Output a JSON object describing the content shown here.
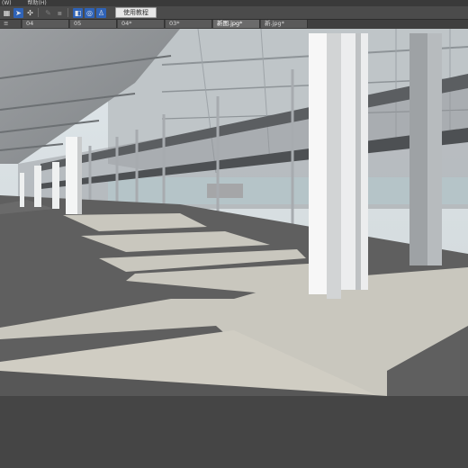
{
  "menubar": {
    "items": [
      "(W)",
      "帮助(H)"
    ]
  },
  "toolbar": {
    "icons": [
      "grid-icon",
      "select-arrow-icon",
      "move-icon",
      "pencil-icon",
      "paint-icon",
      "camera-icon",
      "orbit-icon",
      "walk-icon"
    ],
    "help_label": "使用教程"
  },
  "tabs": [
    {
      "label": "04"
    },
    {
      "label": "05"
    },
    {
      "label": "04*"
    },
    {
      "label": "03*"
    },
    {
      "label": "新图.jpg*"
    },
    {
      "label": "新.jpg*"
    }
  ],
  "colors": {
    "toolbar_bg": "#4b4b4b",
    "active_tool": "#2f63b7",
    "floor": "#5f5f5f",
    "sunlit_floor": "#c9c7be"
  }
}
